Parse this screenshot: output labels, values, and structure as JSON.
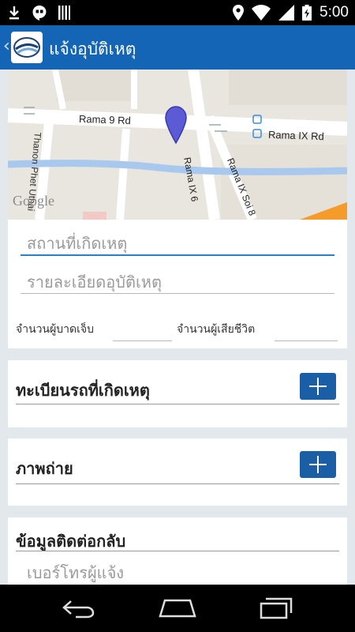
{
  "status_bar": {
    "time": "5:00"
  },
  "action_bar": {
    "back_glyph": "‹",
    "title": "แจ้งอุบัติเหตุ"
  },
  "map": {
    "road_labels": [
      "Rama 9 Rd",
      "Rama IX Rd",
      "Rama IX 6",
      "Rama IX Soi 8",
      "Thanon Phet Uthai"
    ],
    "watermark": "Google"
  },
  "form": {
    "location_placeholder": "สถานที่เกิดเหตุ",
    "details_placeholder": "รายละเอียดอุบัติเหตุ",
    "injured_label": "จำนวนผู้บาดเจ็บ",
    "deaths_label": "จำนวนผู้เสียชีวิต"
  },
  "sections": {
    "vehicles_title": "ทะเบียนรถที่เกิดเหตุ",
    "photos_title": "ภาพถ่าย",
    "contact_title": "ข้อมูลติดต่อกลับ",
    "phone_placeholder": "เบอร์โทรผู้แจ้ง"
  },
  "colors": {
    "action_bar": "#1565b7",
    "accent": "#1a5ea6",
    "marker": "#5b5bd6"
  }
}
